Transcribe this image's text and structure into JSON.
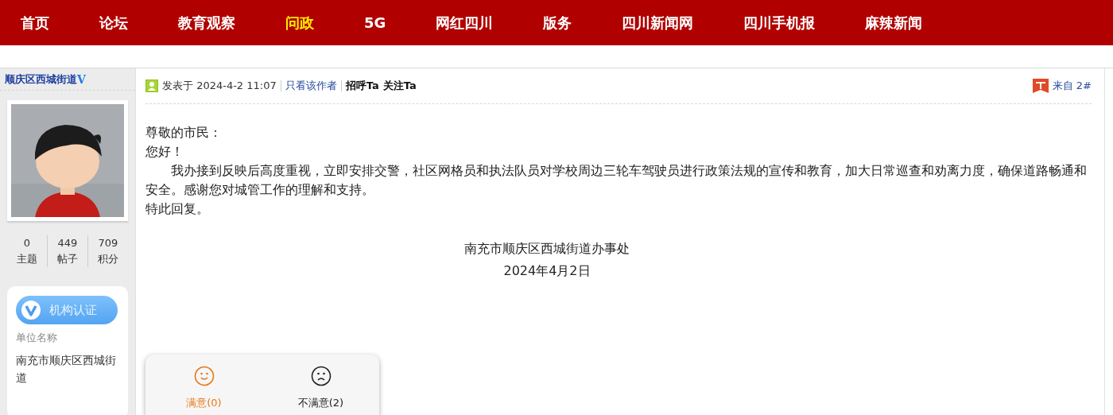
{
  "nav": [
    {
      "label": "首页",
      "selected": false
    },
    {
      "label": "论坛",
      "selected": false
    },
    {
      "label": "教育观察",
      "selected": false
    },
    {
      "label": "问政",
      "selected": true
    },
    {
      "label": "5G",
      "selected": false
    },
    {
      "label": "网红四川",
      "selected": false
    },
    {
      "label": "版务",
      "selected": false
    },
    {
      "label": "四川新闻网",
      "selected": false
    },
    {
      "label": "四川手机报",
      "selected": false
    },
    {
      "label": "麻辣新闻",
      "selected": false
    }
  ],
  "author": {
    "name": "顺庆区西城街道",
    "verified_mark": "V",
    "stats": [
      {
        "value": "0",
        "label": "主题"
      },
      {
        "value": "449",
        "label": "帖子"
      },
      {
        "value": "709",
        "label": "积分"
      }
    ],
    "badge": "机构认证",
    "unit_label": "单位名称",
    "unit_name": "南充市顺庆区西城街道"
  },
  "post": {
    "posted": "发表于 2024-4-2 11:07",
    "only_author": "只看该作者",
    "greet": "招呼Ta",
    "follow": "关注Ta",
    "floor": "来自 2#",
    "body": [
      "尊敬的市民：",
      "您好！",
      "我办接到反映后高度重视，立即安排交警，社区网格员和执法队员对学校周边三轮车驾驶员进行政策法规的宣传和教育，加大日常巡查和劝离力度，确保道路畅通和安全。感谢您对城管工作的理解和支持。",
      "特此回复。"
    ],
    "signature": [
      "南充市顺庆区西城街道办事处",
      "2024年4月2日"
    ]
  },
  "rating": [
    {
      "kind": "happy",
      "label": "满意(0)",
      "selected": true
    },
    {
      "kind": "sad",
      "label": "不满意(2)",
      "selected": false
    }
  ]
}
